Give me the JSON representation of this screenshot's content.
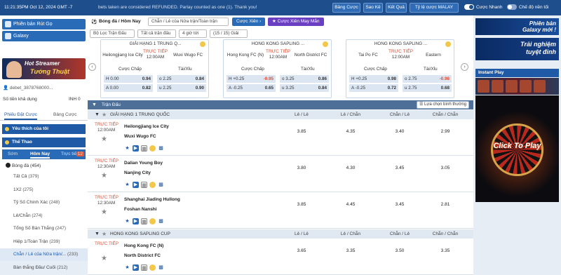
{
  "topbar": {
    "time": "11:21:35PM Oct 12, 2024 GMT -7",
    "marquee": "bets taken are considered REFUNDED. Parlay counted as one (1). Thank you!",
    "buttons": [
      "Bảng Cược",
      "Sao Kê",
      "Kết Quả",
      "Tỷ lệ cược MALAY"
    ],
    "toggle_fast": "Cược Nhanh",
    "toggle_night": "Chế độ nền tối"
  },
  "left": {
    "pill1": "Phiên bản Rút Gọ",
    "pill2": "Galaxy",
    "promo_line1": "Hot Streamer",
    "promo_line2": "Tướng Thuật",
    "username": "debet_3878768000...",
    "credit_label": "Số tiền khả dụng",
    "credit_value": "INH 0",
    "slip_tab1": "Phiếu Đặt Cược",
    "slip_tab2": "Bảng Cược",
    "favorites": "Yêu thích của tôi",
    "sports": "Thể Thao",
    "time_tabs": [
      "Sớm",
      "Hôm Nay",
      "Trực tiếp"
    ],
    "live_badge": "12",
    "soccer": "Bóng đá",
    "soccer_count": "(454)",
    "menu": [
      {
        "label": "Tất Cả",
        "count": "(379)"
      },
      {
        "label": "1X2",
        "count": "(275)"
      },
      {
        "label": "Tỷ Số Chính Xác",
        "count": "(248)"
      },
      {
        "label": "Lẻ/Chẵn",
        "count": "(274)"
      },
      {
        "label": "Tổng Số Bàn Thắng",
        "count": "(247)"
      },
      {
        "label": "Hiệp 1/Toàn Trận",
        "count": "(239)"
      },
      {
        "label": "Chẵn / Lẻ của Nửa trận/...",
        "count": "(233)"
      },
      {
        "label": "Bàn thắng Đầu/ Cuối",
        "count": "(212)"
      }
    ]
  },
  "center": {
    "title": "Bóng đá / Hôm Nay",
    "market_dd": "Chẵn / Lẻ của Nửa trận/Toàn trận",
    "btn_parlay": "Cược Xiên",
    "btn_lucky": "Cược Xiên May Mắn",
    "filter_league": "Bộ Lọc Trận Đấu",
    "filter_all": "Tất cả trận đấu",
    "filter_hours": "4 giờ tới",
    "filter_count": "(15 / 15) Giải",
    "cards": [
      {
        "league": "GIẢI HẠNG 1 TRUNG Q...",
        "status": "TRỰC TIẾP",
        "time": "12:00AM",
        "home": "Heilongjiang Ice City",
        "away": "Wuxi Wugo FC",
        "hdr_hc": "Cược Chấp",
        "hdr_ou": "Tài/Xỉu",
        "rows": [
          [
            "H 0.00",
            "0.94",
            "o 2.25",
            "0.84"
          ],
          [
            "A 0.00",
            "0.82",
            "u 2.25",
            "0.90"
          ]
        ]
      },
      {
        "league": "HONG KONG SAPLING ...",
        "status": "TRỰC TIẾP",
        "time": "12:00AM",
        "home": "Hong Kong FC (N)",
        "away": "North District FC",
        "hdr_hc": "Cược Chấp",
        "hdr_ou": "Tài/Xỉu",
        "rows": [
          [
            "H +0.25",
            "-0.95",
            "o 3.25",
            "0.86"
          ],
          [
            "A -0.25",
            "0.65",
            "u 3.25",
            "0.84"
          ]
        ]
      },
      {
        "league": "HONG KONG SAPLING ...",
        "status": "TRỰC TIẾP",
        "time": "12:00AM",
        "home": "Tai Po FC",
        "away": "Eastern",
        "hdr_hc": "Cược Chấp",
        "hdr_ou": "Tài/Xỉu",
        "rows": [
          [
            "H +0.25",
            "0.98",
            "o 2.75",
            "-0.98"
          ],
          [
            "A -0.25",
            "0.72",
            "u 2.75",
            "0.68"
          ]
        ]
      }
    ],
    "match_header": "Trận Đấu",
    "sort_label": "Lựa chọn bình thường",
    "col_labels": [
      "Lẻ / Lẻ",
      "Lẻ / Chẵn",
      "Chẵn / Lẻ",
      "Chẵn / Chẵn"
    ],
    "leagues": [
      {
        "name": "GIẢI HẠNG 1 TRUNG QUỐC",
        "matches": [
          {
            "status": "TRỰC TIẾP",
            "time": "12:00AM",
            "home": "Heilongjiang Ice City",
            "away": "Wuxi Wugo FC",
            "odds": [
              "3.85",
              "4.35",
              "3.40",
              "2.99"
            ]
          },
          {
            "status": "TRỰC TIẾP",
            "time": "12:30AM",
            "home": "Dalian Young Boy",
            "away": "Nanjing City",
            "odds": [
              "3.80",
              "4.30",
              "3.45",
              "3.05"
            ]
          },
          {
            "status": "TRỰC TIẾP",
            "time": "12:30AM",
            "home": "Shanghai Jiading Hullong",
            "away": "Foshan Nanshi",
            "odds": [
              "3.85",
              "4.45",
              "3.45",
              "2.81"
            ]
          }
        ]
      },
      {
        "name": "HONG KONG SAPLING CUP",
        "matches": [
          {
            "status": "TRỰC TIẾP",
            "time": "",
            "home": "Hong Kong FC (N)",
            "away": "North District FC",
            "odds": [
              "3.65",
              "3.35",
              "3.50",
              "3.35"
            ]
          }
        ]
      }
    ]
  },
  "right": {
    "banner1_line1": "Phiên bản",
    "banner1_line2": "Galaxy mới !",
    "banner2_line1": "Trải nghiệm",
    "banner2_line2": "tuyệt đỉnh",
    "instant_play": "Instant Play",
    "casino_cta": "Click To Play"
  },
  "colors": {
    "accent": "#1f5aa6",
    "live": "#e04b2f",
    "topbar": "#1e4e8c",
    "league_bar": "#4d6f98"
  }
}
